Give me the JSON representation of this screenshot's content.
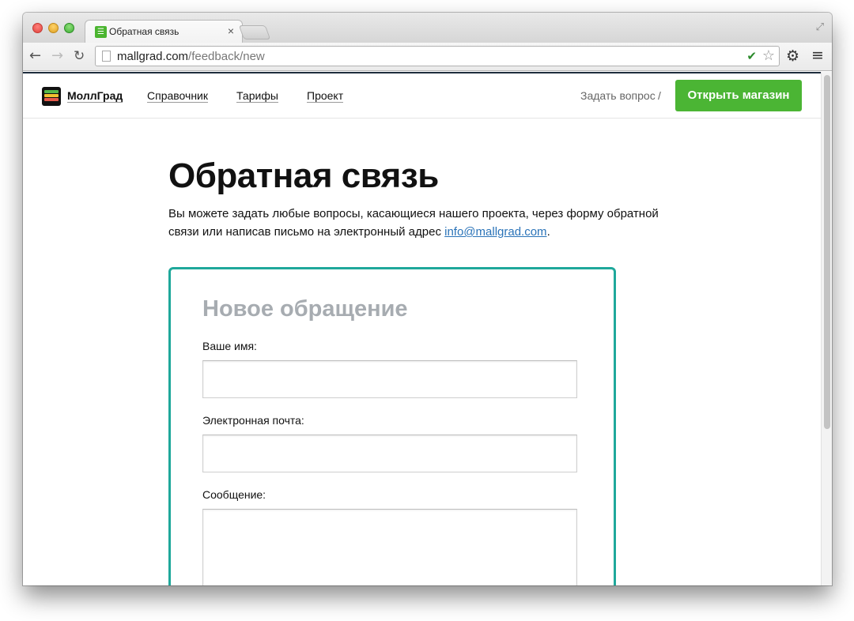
{
  "browser": {
    "tab_title": "Обратная связь",
    "tab_close": "×",
    "url_host": "mallgrad.com",
    "url_path": "/feedback/new"
  },
  "icons": {
    "back": "arrow-left-icon",
    "forward": "arrow-right-icon",
    "reload": "reload-icon",
    "star": "star-icon",
    "gear": "gear-icon",
    "menu": "hamburger-menu-icon",
    "extension": "checkmark-extension-icon",
    "fullscreen": "fullscreen-icon"
  },
  "header": {
    "logo": "МоллГрад",
    "nav": [
      {
        "label": "Справочник"
      },
      {
        "label": "Тарифы"
      },
      {
        "label": "Проект"
      }
    ],
    "ask_question": "Задать вопрос",
    "separator": "/",
    "open_shop": "Открыть магазин"
  },
  "page": {
    "title": "Обратная связь",
    "intro_before": "Вы можете задать любые вопросы, касающиеся нашего проекта, через форму обратной связи или написав письмо на электронный адрес ",
    "intro_email": "info@mallgrad.com",
    "intro_after": "."
  },
  "form": {
    "title": "Новое обращение",
    "name_label": "Ваше имя:",
    "name_value": "",
    "email_label": "Электронная почта:",
    "email_value": "",
    "message_label": "Сообщение:",
    "message_value": ""
  },
  "colors": {
    "accent_green": "#4bb534",
    "form_border": "#1fa89b",
    "link": "#2a73b8",
    "form_title": "#a7acb1"
  }
}
